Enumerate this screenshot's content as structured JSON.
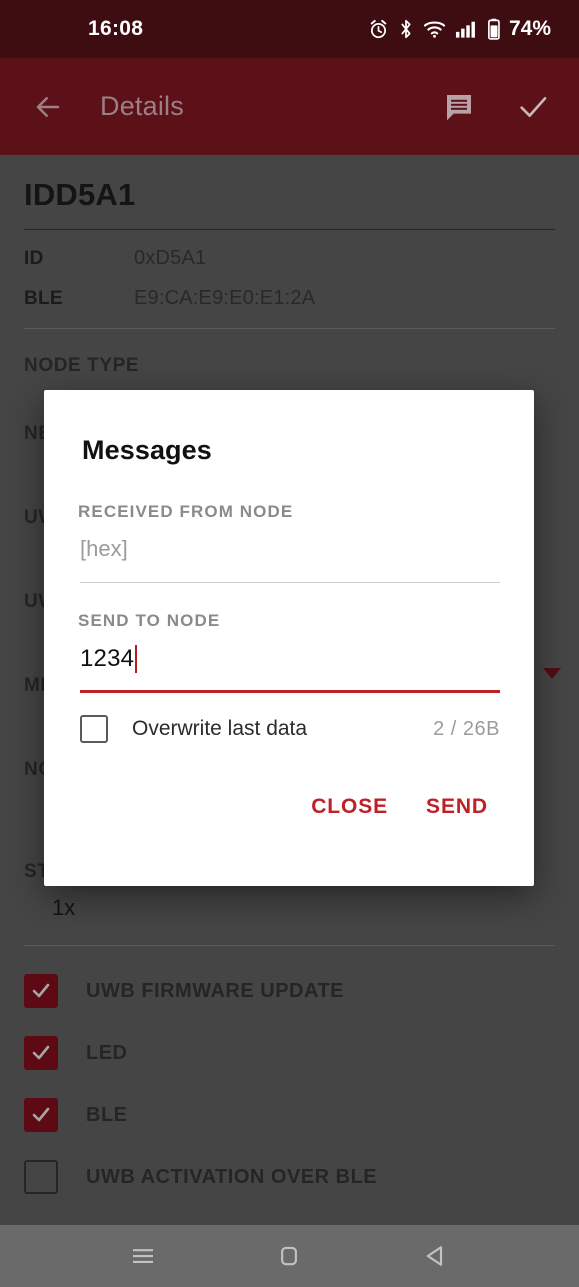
{
  "status_bar": {
    "clock": "16:08",
    "battery_percent": "74%",
    "icons": [
      "alarm-icon",
      "bluetooth-icon",
      "wifi-icon",
      "cellular-signal-icon",
      "battery-icon"
    ],
    "background_color": "#3d0d12"
  },
  "app_bar": {
    "back_label": "back-arrow",
    "title": "Details",
    "messages_label": "messages",
    "confirm_label": "confirm",
    "background_color": "#5c1018",
    "title_color": "#9b8086"
  },
  "details": {
    "device_title": "IDD5A1",
    "properties": [
      {
        "key": "ID",
        "value": "0xD5A1"
      },
      {
        "key": "BLE",
        "value": "E9:CA:E9:E0:E1:2A"
      }
    ],
    "node_type_label": "NODE TYPE",
    "obscured_labels": [
      "NE",
      "UW",
      "UW",
      "MI",
      "NO"
    ],
    "stationary_label": "STATIONARY UPDATE RATE",
    "stationary_value": "1x",
    "toggles": [
      {
        "label": "UWB FIRMWARE UPDATE",
        "checked": true
      },
      {
        "label": "LED",
        "checked": true
      },
      {
        "label": "BLE",
        "checked": true
      },
      {
        "label": "UWB ACTIVATION OVER BLE",
        "checked": false
      }
    ],
    "accent_checked_color": "#8f1020"
  },
  "dialog": {
    "title": "Messages",
    "received_label": "RECEIVED FROM NODE",
    "received_placeholder": "[hex]",
    "received_value": "",
    "send_label": "SEND TO NODE",
    "send_value": "1234",
    "send_placeholder": "[hex]",
    "overwrite_label": "Overwrite last data",
    "overwrite_checked": false,
    "counter": "2 / 26B",
    "close_label": "CLOSE",
    "send_button_label": "SEND",
    "accent_color": "#bf2026"
  },
  "nav_bar": {
    "recents_label": "recents",
    "home_label": "home",
    "back_label": "back"
  }
}
